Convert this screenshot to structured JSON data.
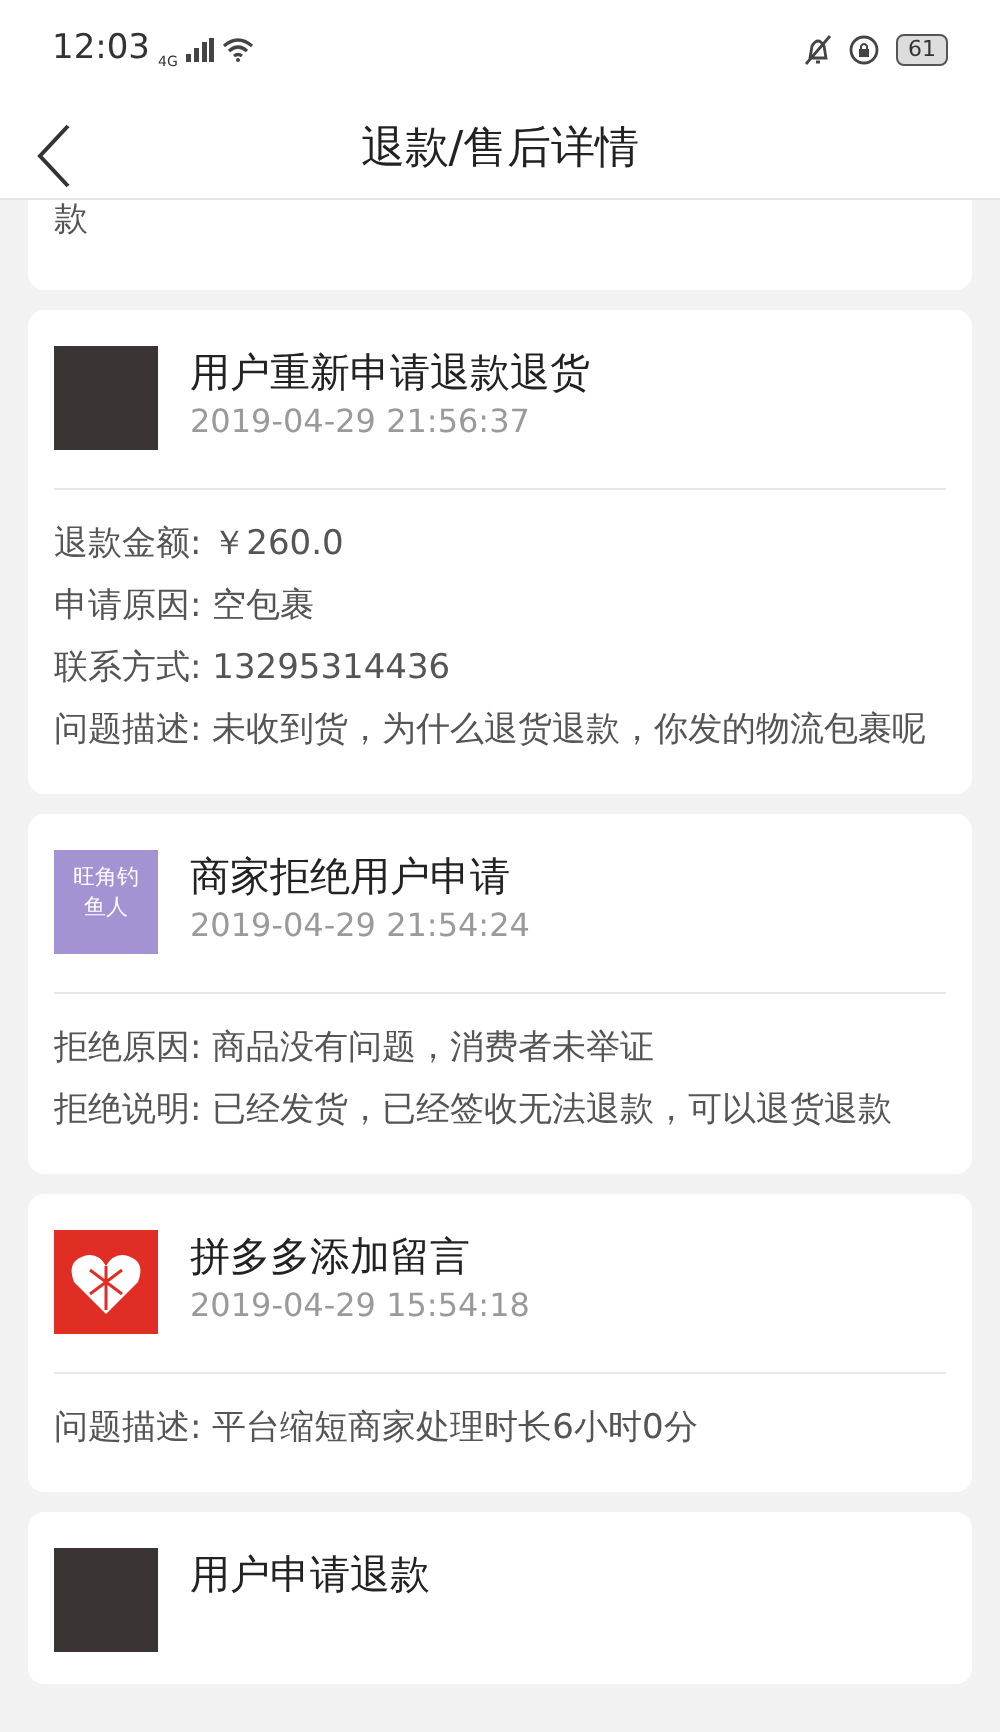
{
  "status_bar": {
    "time": "12:03",
    "network": "4G",
    "battery": "61"
  },
  "header": {
    "title": "退款/售后详情"
  },
  "partial_card": {
    "text": "款"
  },
  "records": [
    {
      "avatar": {
        "kind": "photo"
      },
      "title": "用户重新申请退款退货",
      "time": "2019-04-29 21:56:37",
      "lines": [
        "退款金额: ￥260.0",
        "申请原因: 空包裹",
        "联系方式: 13295314436",
        "问题描述: 未收到货，为什么退货退款，你发的物流包裹呢"
      ]
    },
    {
      "avatar": {
        "kind": "text",
        "text": "旺角钓鱼人",
        "color": "#a393d3"
      },
      "title": "商家拒绝用户申请",
      "time": "2019-04-29 21:54:24",
      "lines": [
        "拒绝原因: 商品没有问题，消费者未举证",
        "拒绝说明: 已经发货，已经签收无法退款，可以退货退款"
      ]
    },
    {
      "avatar": {
        "kind": "logo"
      },
      "title": "拼多多添加留言",
      "time": "2019-04-29 15:54:18",
      "lines": [
        "问题描述: 平台缩短商家处理时长6小时0分"
      ]
    },
    {
      "avatar": {
        "kind": "photo"
      },
      "title": "用户申请退款"
    }
  ]
}
